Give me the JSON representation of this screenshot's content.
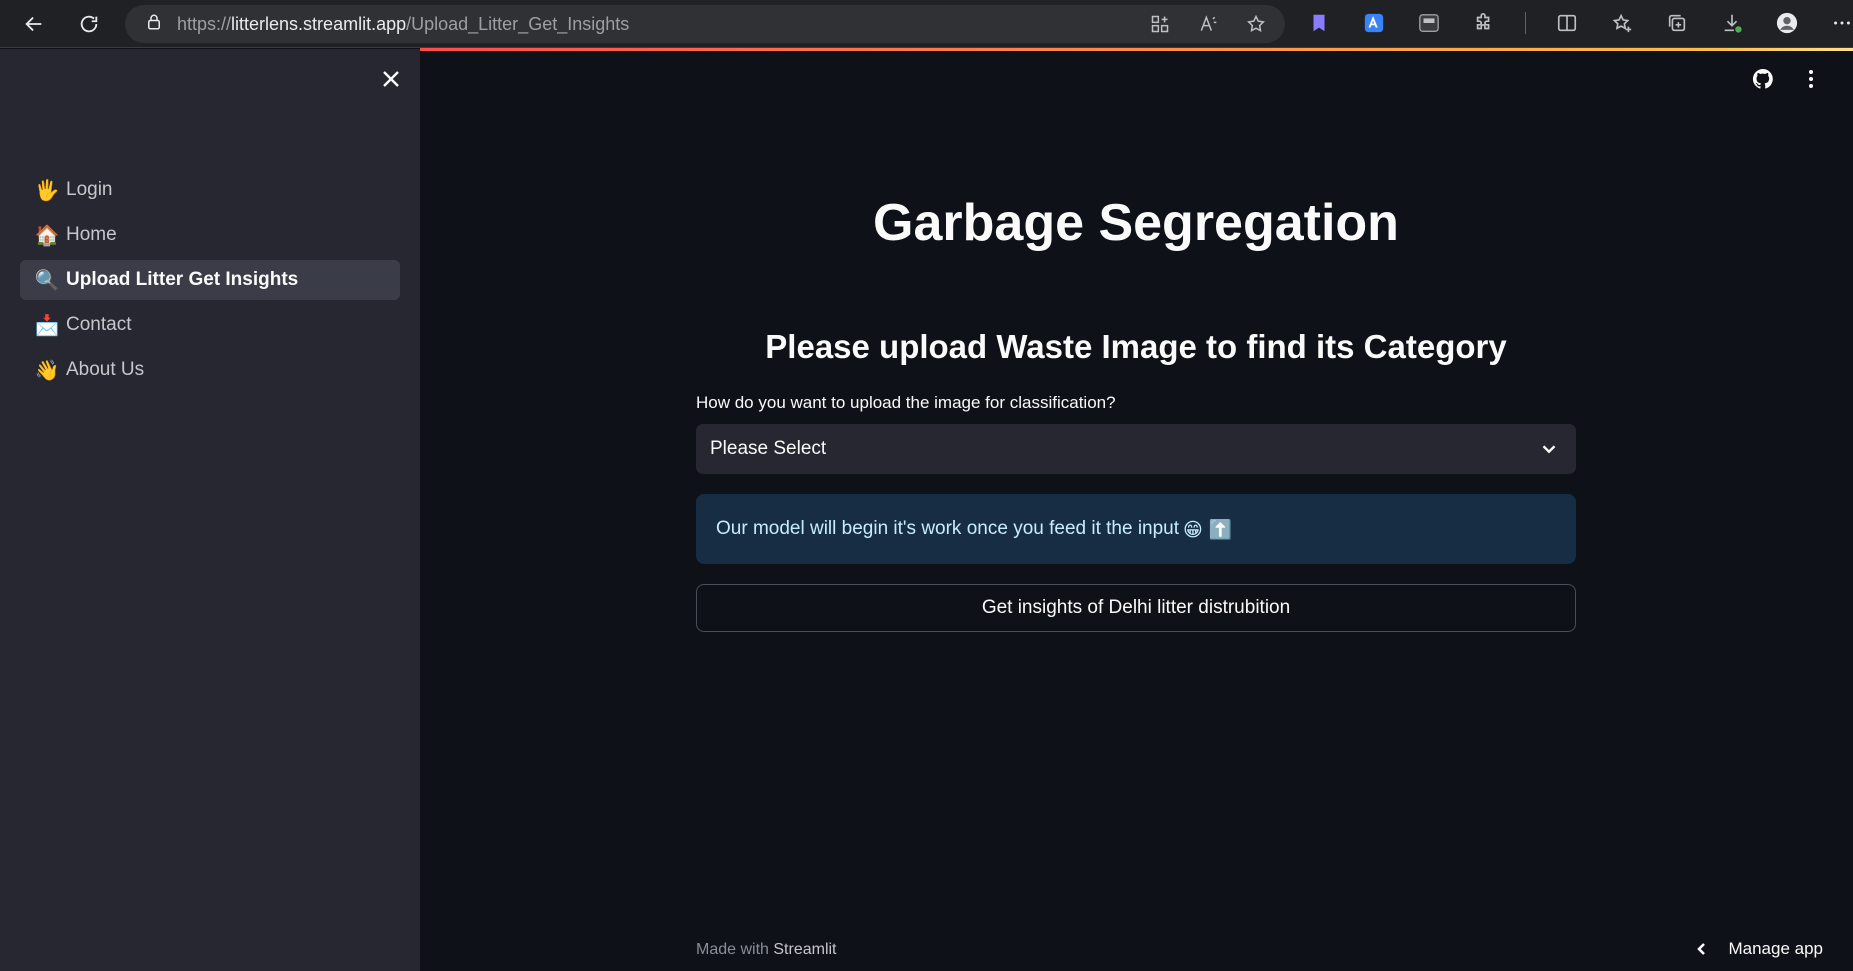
{
  "browser": {
    "url_scheme": "https://",
    "url_host": "litterlens.streamlit.app",
    "url_path": "/Upload_Litter_Get_Insights"
  },
  "sidebar": {
    "items": [
      {
        "emoji": "🖐",
        "label": "Login",
        "active": false
      },
      {
        "emoji": "🏠",
        "label": "Home",
        "active": false
      },
      {
        "emoji": "🔍",
        "label": "Upload Litter Get Insights",
        "active": true
      },
      {
        "emoji": "📩",
        "label": "Contact",
        "active": false
      },
      {
        "emoji": "👋",
        "label": "About Us",
        "active": false
      }
    ]
  },
  "main": {
    "title": "Garbage Segregation",
    "subtitle": "Please upload Waste Image to find its Category",
    "select_label": "How do you want to upload the image for classification?",
    "select_value": "Please Select",
    "info_text": "Our model will begin it's work once you feed it the input",
    "info_emoji": "😁 ⬆️",
    "insights_button": "Get insights of Delhi litter distrubition"
  },
  "footer": {
    "made_with": "Made with ",
    "brand": "Streamlit",
    "manage_app": "Manage app"
  },
  "colors": {
    "sidebar_bg": "#262730",
    "main_bg": "#0e1117",
    "info_bg": "#172d43",
    "accent": "#ff4b4b"
  }
}
